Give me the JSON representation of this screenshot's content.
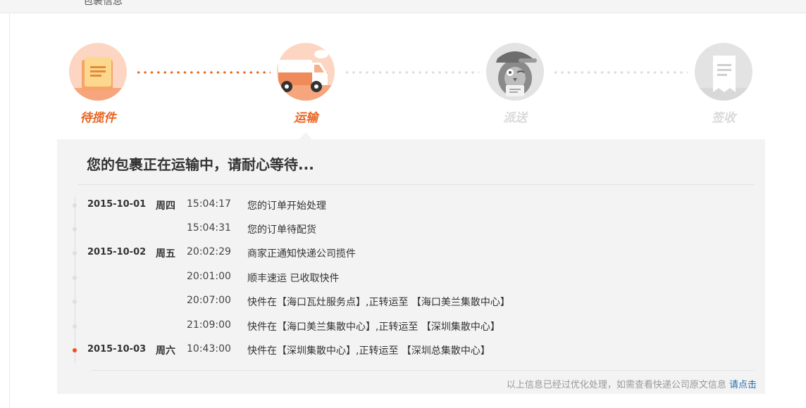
{
  "header_partial_text": "包裹信息",
  "steps": [
    {
      "label": "待揽件",
      "icon": "package-list-icon",
      "state": "done"
    },
    {
      "label": "运输",
      "icon": "truck-icon",
      "state": "current"
    },
    {
      "label": "派送",
      "icon": "courier-icon",
      "state": "pending"
    },
    {
      "label": "签收",
      "icon": "receipt-icon",
      "state": "pending"
    }
  ],
  "panel": {
    "title": "您的包裹正在运输中，请耐心等待...",
    "events": [
      {
        "date": "2015-10-01",
        "weekday": "周四",
        "time": "15:04:17",
        "desc": "您的订单开始处理",
        "current": false
      },
      {
        "date": "",
        "weekday": "",
        "time": "15:04:31",
        "desc": "您的订单待配货",
        "current": false
      },
      {
        "date": "2015-10-02",
        "weekday": "周五",
        "time": "20:02:29",
        "desc": "商家正通知快递公司揽件",
        "current": false
      },
      {
        "date": "",
        "weekday": "",
        "time": "20:01:00",
        "desc": "顺丰速运 已收取快件",
        "current": false
      },
      {
        "date": "",
        "weekday": "",
        "time": "20:07:00",
        "desc": "快件在【海口瓦灶服务点】,正转运至 【海口美兰集散中心】",
        "current": false
      },
      {
        "date": "",
        "weekday": "",
        "time": "21:09:00",
        "desc": "快件在【海口美兰集散中心】,正转运至 【深圳集散中心】",
        "current": false
      },
      {
        "date": "2015-10-03",
        "weekday": "周六",
        "time": "10:43:00",
        "desc": "快件在【深圳集散中心】,正转运至 【深圳总集散中心】",
        "current": true
      }
    ],
    "footer_text": "以上信息已经过优化处理，如需查看快递公司原文信息",
    "footer_link": "请点击"
  },
  "colors": {
    "accent": "#e8631f",
    "inactive": "#d9d9d9",
    "link": "#2b6cb0"
  }
}
